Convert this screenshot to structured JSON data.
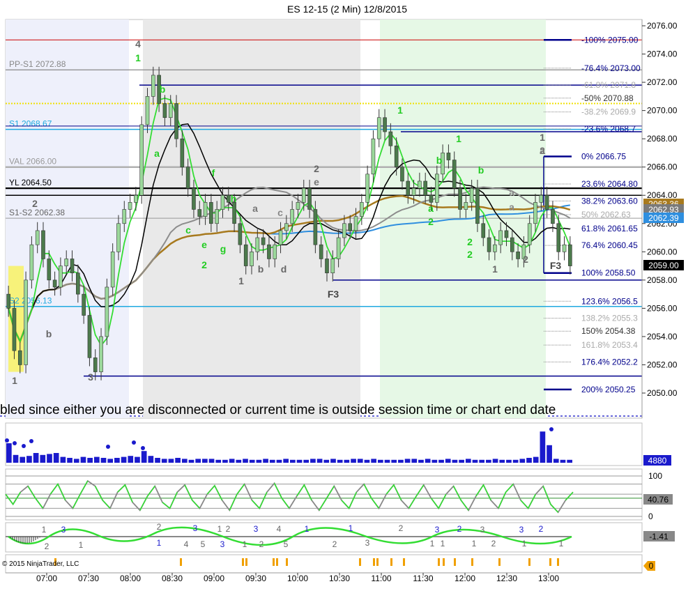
{
  "window": {
    "title": "ES 12-15 (2 Min)  12/8/2015",
    "copyright": "© 2015 NinjaTrader, LLC",
    "banner": "bled since either you are disconnected or current time is outside session time or chart end date"
  },
  "colors": {
    "background": "#ffffff",
    "session_shade_1": "#eef0fb",
    "session_shade_2": "#e9e9e9",
    "session_shade_3": "#e6f8e6",
    "candle_body": "#5c8a5c",
    "candle_up_fill": "#9bd89b",
    "fib_navy": "#00008b",
    "s1_cyan": "#1fa9e0",
    "vwap_blue": "#2f8fdf",
    "ma_gold": "#a87a1e",
    "ma_gray": "#8c8c8c",
    "ema_green": "#33dd33",
    "black_line": "#000000",
    "red_line": "#cc0000",
    "yellow_dotted": "#f0e000",
    "label_green": "#22cc22",
    "label_gray": "#666666"
  },
  "chart_data": [
    {
      "type": "candlestick",
      "title": "ES 12-15 (2 Min)  12/8/2015",
      "ylim": [
        2049,
        2076.5
      ],
      "y_ticks": [
        "2076.00",
        "2074.00",
        "2072.00",
        "2070.00",
        "2068.00",
        "2066.00",
        "2064.00",
        "2062.00",
        "2060.00",
        "2058.00",
        "2056.00",
        "2054.00",
        "2052.00",
        "2050.00"
      ],
      "x_tick_labels": [
        "07:00",
        "07:30",
        "08:00",
        "08:30",
        "09:00",
        "09:30",
        "10:00",
        "10:30",
        "11:00",
        "11:30",
        "12:00",
        "12:30",
        "13:00"
      ],
      "price_levels": [
        {
          "name": "PP-S1",
          "value": 2072.88,
          "label": "PP-S1 2072.88"
        },
        {
          "name": "S1",
          "value": 2068.67,
          "label": "S1 2068.67"
        },
        {
          "name": "VAL",
          "value": 2066.0,
          "label": "VAL 2066.00"
        },
        {
          "name": "YL",
          "value": 2064.5,
          "label": "YL 2064.50"
        },
        {
          "name": "S1-S2",
          "value": 2062.38,
          "label": "S1-S2 2062.38"
        },
        {
          "name": "S2",
          "value": 2056.13,
          "label": "S2 2056.13"
        }
      ],
      "fib_levels": [
        {
          "pct": "-100%",
          "value": "2075.00"
        },
        {
          "pct": "-76.4%",
          "value": "2073.00"
        },
        {
          "pct": "-61.8%",
          "value": "2071.8"
        },
        {
          "pct": "-50%",
          "value": "2070.88"
        },
        {
          "pct": "-38.2%",
          "value": "2069.9"
        },
        {
          "pct": "-23.6%",
          "value": "2068.7"
        },
        {
          "pct": "0%",
          "value": "2066.75"
        },
        {
          "pct": "23.6%",
          "value": "2064.80"
        },
        {
          "pct": "38.2%",
          "value": "2063.60"
        },
        {
          "pct": "50%",
          "value": "2062.63"
        },
        {
          "pct": "61.8%",
          "value": "2061.65"
        },
        {
          "pct": "76.4%",
          "value": "2060.45"
        },
        {
          "pct": "100%",
          "value": "2058.50"
        },
        {
          "pct": "123.6%",
          "value": "2056.5"
        },
        {
          "pct": "138.2%",
          "value": "2055.3"
        },
        {
          "pct": "150%",
          "value": "2054.38"
        },
        {
          "pct": "161.8%",
          "value": "2053.4"
        },
        {
          "pct": "176.4%",
          "value": "2052.2"
        },
        {
          "pct": "200%",
          "value": "2050.25"
        }
      ],
      "price_badges": [
        "2063.36",
        "2062.93",
        "2062.39",
        "2059.00"
      ],
      "price_values": [
        2063.36,
        2062.93,
        2062.39,
        2059.0
      ],
      "wave_labels": [
        "4",
        "1",
        "b",
        "a",
        "1",
        "2",
        "b",
        "3",
        "c",
        "e",
        "2",
        "f",
        "h",
        "g",
        "a",
        "1",
        "b",
        "d",
        "c",
        "2",
        "e",
        "F3",
        "1",
        "b",
        "1",
        "a",
        "2",
        "b",
        "a",
        "2",
        "2",
        "a",
        "1",
        "2",
        "1",
        "F3",
        "2",
        "a"
      ],
      "close_series": [
        2056.0,
        2053.0,
        2052.0,
        2058.0,
        2060.5,
        2061.5,
        2059.5,
        2058.0,
        2057.5,
        2059.0,
        2059.5,
        2058.5,
        2057.0,
        2055.5,
        2052.5,
        2051.5,
        2054.0,
        2057.5,
        2060.0,
        2062.0,
        2063.0,
        2063.5,
        2064.0,
        2069.0,
        2071.0,
        2072.5,
        2070.5,
        2069.5,
        2070.5,
        2068.0,
        2066.0,
        2064.5,
        2063.0,
        2062.5,
        2063.5,
        2062.0,
        2063.0,
        2064.0,
        2063.5,
        2062.0,
        2060.5,
        2059.0,
        2060.0,
        2061.0,
        2060.5,
        2059.5,
        2060.5,
        2061.5,
        2062.0,
        2063.0,
        2063.5,
        2064.5,
        2063.0,
        2060.5,
        2059.5,
        2058.5,
        2059.5,
        2061.0,
        2062.0,
        2061.5,
        2062.5,
        2063.5,
        2065.5,
        2068.0,
        2069.5,
        2068.5,
        2067.5,
        2066.0,
        2065.0,
        2064.0,
        2064.5,
        2065.0,
        2064.0,
        2063.5,
        2065.5,
        2067.0,
        2066.5,
        2064.5,
        2063.0,
        2063.5,
        2064.5,
        2062.0,
        2061.0,
        2060.0,
        2060.5,
        2061.5,
        2061.0,
        2060.0,
        2059.5,
        2060.5,
        2062.0,
        2063.5,
        2064.0,
        2063.0,
        2062.0,
        2060.0,
        2060.5,
        2059.0
      ]
    },
    {
      "type": "bar",
      "name": "volume",
      "badge": "4880",
      "values": [
        1.0,
        0.4,
        0.3,
        0.35,
        0.5,
        0.4,
        0.45,
        0.5,
        0.3,
        0.25,
        0.2,
        0.3,
        0.25,
        0.3,
        0.25,
        0.2,
        0.25,
        0.3,
        0.35,
        0.3,
        0.6,
        0.35,
        0.25,
        0.2,
        0.2,
        0.25,
        0.2,
        0.15,
        0.2,
        0.2,
        0.2,
        0.15,
        0.15,
        0.2,
        0.15,
        0.2,
        0.15,
        0.15,
        0.2,
        0.15,
        0.15,
        0.2,
        0.15,
        0.15,
        0.15,
        0.2,
        0.2,
        0.15,
        0.2,
        0.15,
        0.15,
        0.2,
        0.2,
        0.15,
        0.2,
        0.15,
        0.15,
        0.15,
        0.15,
        0.2,
        0.2,
        0.15,
        0.2,
        0.15,
        0.15,
        0.2,
        0.15,
        0.15,
        0.2,
        0.15,
        0.15,
        0.15,
        0.2,
        0.15,
        0.15,
        0.15,
        0.2,
        0.25,
        0.3,
        1.6,
        0.9,
        0.2,
        0.15,
        0.15
      ]
    },
    {
      "type": "line",
      "name": "oscillator",
      "badge": "40.76",
      "y_ticks": [
        "100",
        "0"
      ],
      "values": [
        55,
        30,
        60,
        75,
        45,
        20,
        55,
        80,
        40,
        20,
        55,
        88,
        75,
        40,
        20,
        60,
        78,
        35,
        15,
        50,
        75,
        35,
        20,
        60,
        78,
        40,
        20,
        55,
        76,
        40,
        15,
        55,
        80,
        40,
        20,
        60,
        82,
        45,
        20,
        50,
        78,
        40,
        15,
        45,
        75,
        40,
        20,
        60,
        80,
        45,
        20,
        55,
        78,
        40,
        20,
        50,
        78,
        45,
        20,
        55,
        75,
        40,
        15,
        50,
        78,
        40,
        20,
        60,
        80,
        40,
        20,
        55,
        75,
        30,
        10,
        40,
        60
      ]
    },
    {
      "type": "line",
      "name": "histogram",
      "badge": "-1.41",
      "labels": [
        "1",
        "3",
        "2",
        "1",
        "2",
        "1",
        "4",
        "3",
        "5",
        "1",
        "2",
        "3",
        "1",
        "3",
        "2",
        "4",
        "5",
        "1",
        "2",
        "1",
        "3",
        "2",
        "1",
        "3",
        "1",
        "2",
        "1",
        "3",
        "2",
        "3",
        "1",
        "2",
        "1"
      ]
    },
    {
      "type": "bar",
      "name": "signals",
      "badge": "0",
      "values": [
        1,
        1,
        1,
        1,
        1,
        1,
        1,
        1,
        1,
        1,
        1,
        1,
        1,
        1,
        1,
        1,
        1,
        1,
        1,
        1,
        1,
        1,
        1,
        1
      ]
    }
  ]
}
